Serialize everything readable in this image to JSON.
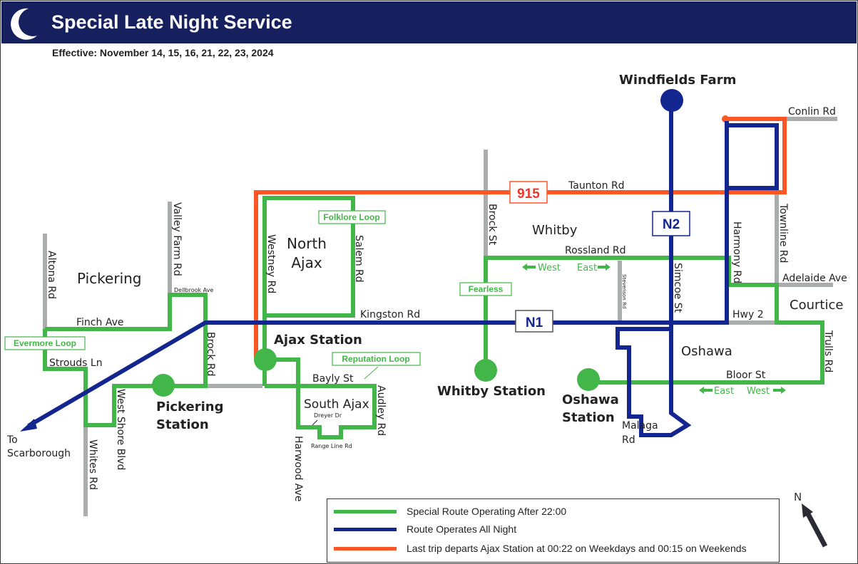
{
  "header": {
    "title": "Special Late Night Service",
    "icon": "crescent-moon-icon",
    "effective": "Effective: November 14, 15, 16, 21, 22, 23, 2024"
  },
  "colors": {
    "header_bg": "#16205e",
    "special_green": "#43b649",
    "all_night_blue": "#13258f",
    "last_trip_orange": "#fc5526",
    "street_gray": "#a9aeac"
  },
  "areas": {
    "pickering": "Pickering",
    "north_ajax_1": "North",
    "north_ajax_2": "Ajax",
    "south_ajax": "South Ajax",
    "whitby": "Whitby",
    "oshawa": "Oshawa",
    "courtice": "Courtice"
  },
  "stations": {
    "pickering_1": "Pickering",
    "pickering_2": "Station",
    "ajax": "Ajax Station",
    "whitby": "Whitby Station",
    "oshawa_1": "Oshawa",
    "oshawa_2": "Station",
    "windfields": "Windfields Farm",
    "scarborough_1": "To",
    "scarborough_2": "Scarborough"
  },
  "route_badges": {
    "r915": "915",
    "n1": "N1",
    "n2": "N2"
  },
  "loops": {
    "evermore": "Evermore Loop",
    "folklore": "Folklore Loop",
    "reputation": "Reputation Loop",
    "fearless": "Fearless"
  },
  "streets": {
    "altona": "Altona Rd",
    "valley_farm": "Valley Farm Rd",
    "dellbrook": "Dellbrook Ave",
    "finch": "Finch Ave",
    "strouds": "Strouds Ln",
    "whites": "Whites Rd",
    "west_shore": "West Shore Blvd",
    "brock_rd": "Brock Rd",
    "westney": "Westney Rd",
    "salem": "Salem Rd",
    "kingston": "Kingston Rd",
    "bayly": "Bayly St",
    "dreyer": "Dreyer Dr",
    "range_line": "Range Line Rd",
    "harwood": "Harwood Ave",
    "audley": "Audley Rd",
    "taunton": "Taunton Rd",
    "brock_st": "Brock St",
    "rossland": "Rossland Rd",
    "stevenson": "Stevenson Rd",
    "simcoe": "Simcoe St",
    "harmony": "Harmony Rd",
    "townline": "Townline Rd",
    "conlin": "Conlin Rd",
    "adelaide": "Adelaide  Ave",
    "hwy2": "Hwy 2",
    "trulls": "Trulls Rd",
    "bloor": "Bloor St",
    "malaga_1": "Malaga",
    "malaga_2": "Rd"
  },
  "directions": {
    "rossland_west": "West",
    "rossland_east": "East",
    "bloor_east": "East",
    "bloor_west": "West"
  },
  "legend": [
    {
      "color": "#43b649",
      "label": "Special Route Operating After 22:00"
    },
    {
      "color": "#13258f",
      "label": "Route Operates All Night"
    },
    {
      "color": "#fc5526",
      "label": "Last trip departs Ajax Station at 00:22 on Weekdays and 00:15 on Weekends"
    }
  ],
  "compass": {
    "label": "N"
  }
}
